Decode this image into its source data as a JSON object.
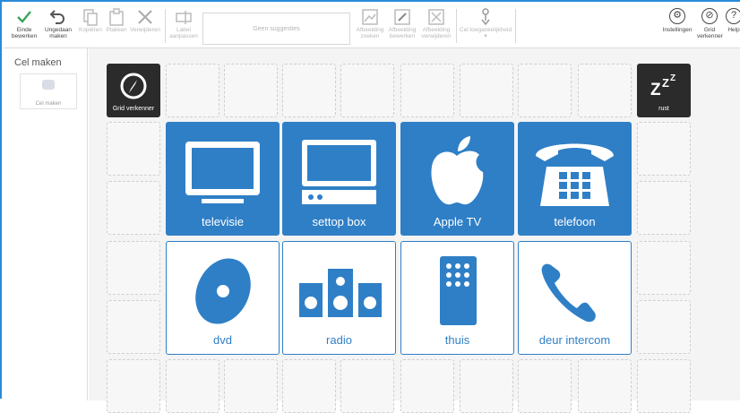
{
  "toolbar": {
    "finish_edit": "Einde bewerken",
    "undo": "Ungedaan maken",
    "copy": "Kopiëren",
    "paste": "Plakken",
    "delete": "Verwijderen",
    "label_edit": "Label aanpassen",
    "search_placeholder": "Geen suggesties",
    "image_search": "Afbeelding zoeken",
    "image_edit": "Afbeelding bewerken",
    "image_delete": "Afbeelding verwijderen",
    "accessibility": "Cel toegankelijkheid",
    "settings": "Instellingen",
    "grid_explorer": "Grid verkenner",
    "help": "Help"
  },
  "left_panel": {
    "title": "Cel maken",
    "card_label": "Cel maken"
  },
  "grid": {
    "nav_tile": "Grid verkenner",
    "rest_tile": "rust",
    "rest_glyph": "ZZZ",
    "tiles": [
      {
        "label": "televisie",
        "icon": "tv-icon"
      },
      {
        "label": "settop box",
        "icon": "settop-box-icon"
      },
      {
        "label": "Apple TV",
        "icon": "apple-icon"
      },
      {
        "label": "telefoon",
        "icon": "telephone-icon"
      },
      {
        "label": "dvd",
        "icon": "disc-icon"
      },
      {
        "label": "radio",
        "icon": "speakers-icon"
      },
      {
        "label": "thuis",
        "icon": "remote-icon"
      },
      {
        "label": "deur intercom",
        "icon": "handset-icon"
      }
    ]
  },
  "colors": {
    "accent": "#2f7fc6",
    "dark_tile": "#2b2b2b",
    "window_border": "#2a8bd8"
  }
}
